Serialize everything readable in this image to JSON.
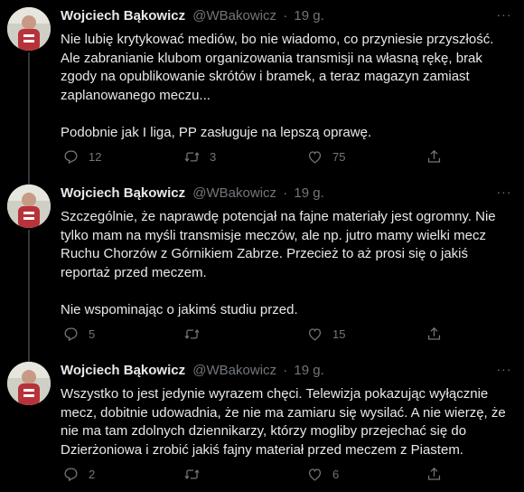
{
  "tweets": [
    {
      "author": "Wojciech Bąkowicz",
      "handle": "@WBakowicz",
      "separator": "·",
      "time": "19 g.",
      "more": "···",
      "text": "Nie lubię krytykować mediów, bo nie wiadomo, co przyniesie przyszłość. Ale zabranianie klubom organizowania transmisji na własną rękę, brak zgody na opublikowanie skrótów i bramek, a teraz magazyn zamiast zaplanowanego meczu...\n\nPodobnie jak I liga, PP zasługuje na lepszą oprawę.",
      "replies": "12",
      "retweets": "3",
      "likes": "75"
    },
    {
      "author": "Wojciech Bąkowicz",
      "handle": "@WBakowicz",
      "separator": "·",
      "time": "19 g.",
      "more": "···",
      "text": "Szczególnie, że naprawdę potencjał na fajne materiały jest ogromny. Nie tylko mam na myśli transmisje meczów, ale np. jutro mamy wielki mecz Ruchu Chorzów z Górnikiem Zabrze. Przecież to aż prosi się o jakiś reportaż przed meczem.\n\nNie wspominając o jakimś studiu przed.",
      "replies": "5",
      "retweets": "",
      "likes": "15"
    },
    {
      "author": "Wojciech Bąkowicz",
      "handle": "@WBakowicz",
      "separator": "·",
      "time": "19 g.",
      "more": "···",
      "text": "Wszystko to jest jedynie wyrazem chęci. Telewizja pokazując wyłącznie mecz, dobitnie udowadnia, że nie ma zamiaru się wysilać. A nie wierzę, że nie ma tam zdolnych dziennikarzy, którzy mogliby przejechać się do Dzierżoniowa i zrobić jakiś fajny materiał przed meczem z Piastem.",
      "replies": "2",
      "retweets": "",
      "likes": "6"
    }
  ],
  "icons": {
    "reply": "reply-icon",
    "retweet": "retweet-icon",
    "like": "heart-icon",
    "share": "share-icon",
    "more": "more-icon"
  },
  "colors": {
    "background": "#000000",
    "text": "#e7e9ea",
    "secondary": "#71767b",
    "thread_line": "#333639"
  }
}
